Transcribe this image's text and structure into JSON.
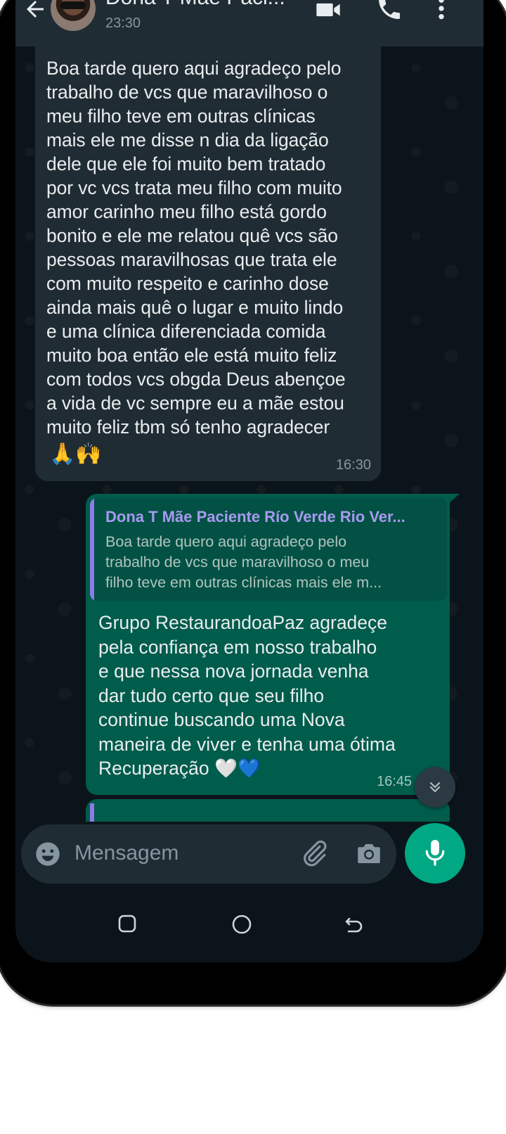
{
  "header": {
    "contact_name": "Dona T Mãe Paci...",
    "status": "23:30"
  },
  "messages": {
    "incoming": {
      "text": "Boa tarde  quero aqui agradeço  pelo\ntrabalho de vcs que maravilhoso o\nmeu filho teve em outras clínicas\nmais ele  me disse  n dia da ligação\ndele que ele foi muito bem tratado\npor vc  vcs trata meu filho com muito\namor carinho  meu filho está gordo\nbonito e  ele me relatou quê vcs são\npessoas maravilhosas que trata ele\ncom muito respeito e carinho dose\nainda mais quê o lugar e muito lindo\ne uma clínica diferenciada comida\nmuito boa então ele está muito feliz\ncom todos vcs obgda Deus abençoe\na vida de vc sempre eu a mãe estou\nmuito feliz tbm só tenho agradecer",
      "emojis": "🙏🙌",
      "time": "16:30"
    },
    "outgoing": {
      "quote_author": "Dona T Mãe Paciente Río Verde Rio Ver...",
      "quote_text": "Boa tarde  quero aqui agradeço  pelo\ntrabalho de vcs que maravilhoso o meu\nfilho teve em outras clínicas mais ele  m...",
      "text": "Grupo RestaurandoaPaz agradeçe\npela confiança em nosso trabalho\ne que nessa nova jornada venha\ndar tudo certo que  seu filho\ncontinue buscando uma Nova\nmaneira de viver e tenha uma ótima\nRecuperação 🤍💙",
      "time": "16:45"
    }
  },
  "input": {
    "placeholder": "Mensagem"
  },
  "colors": {
    "header_bg": "#1f2c34",
    "chat_bg": "#0b141a",
    "incoming_bubble": "#202c33",
    "outgoing_bubble": "#005c4b",
    "accent": "#00a884",
    "quote_bar": "#8f79e6"
  },
  "icons": {
    "back": "arrow-left-icon",
    "video": "video-camera-icon",
    "call": "phone-icon",
    "menu": "more-vertical-icon",
    "scroll": "double-chevron-down-icon",
    "emoji": "emoji-icon",
    "attach": "paperclip-icon",
    "camera": "camera-icon",
    "mic": "microphone-icon"
  }
}
